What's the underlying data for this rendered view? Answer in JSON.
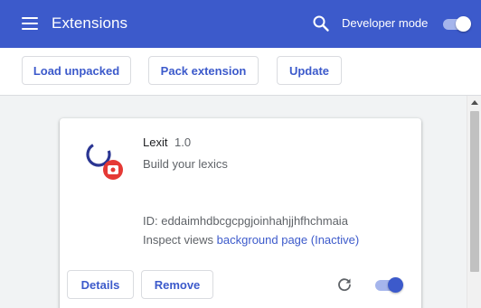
{
  "header": {
    "menu_icon": "hamburger-menu-icon",
    "title": "Extensions",
    "search_icon": "search-icon",
    "developer_mode_label": "Developer mode",
    "developer_mode_enabled": true
  },
  "toolbar": {
    "load_unpacked_label": "Load unpacked",
    "pack_extension_label": "Pack extension",
    "update_label": "Update"
  },
  "extension": {
    "name": "Lexit",
    "version": "1.0",
    "description": "Build your lexics",
    "id_text": "ID: eddaimhdbcgcpgjoinhahjjhfhchmaia",
    "inspect_views_label": "Inspect views",
    "inspect_link": "background page (Inactive)",
    "details_label": "Details",
    "remove_label": "Remove",
    "reload_icon": "reload-icon",
    "enabled": true
  },
  "colors": {
    "header_bg": "#3c5acb",
    "accent": "#3c5acb",
    "page_bg": "#f1f3f4",
    "logo_badge": "#e53935"
  }
}
